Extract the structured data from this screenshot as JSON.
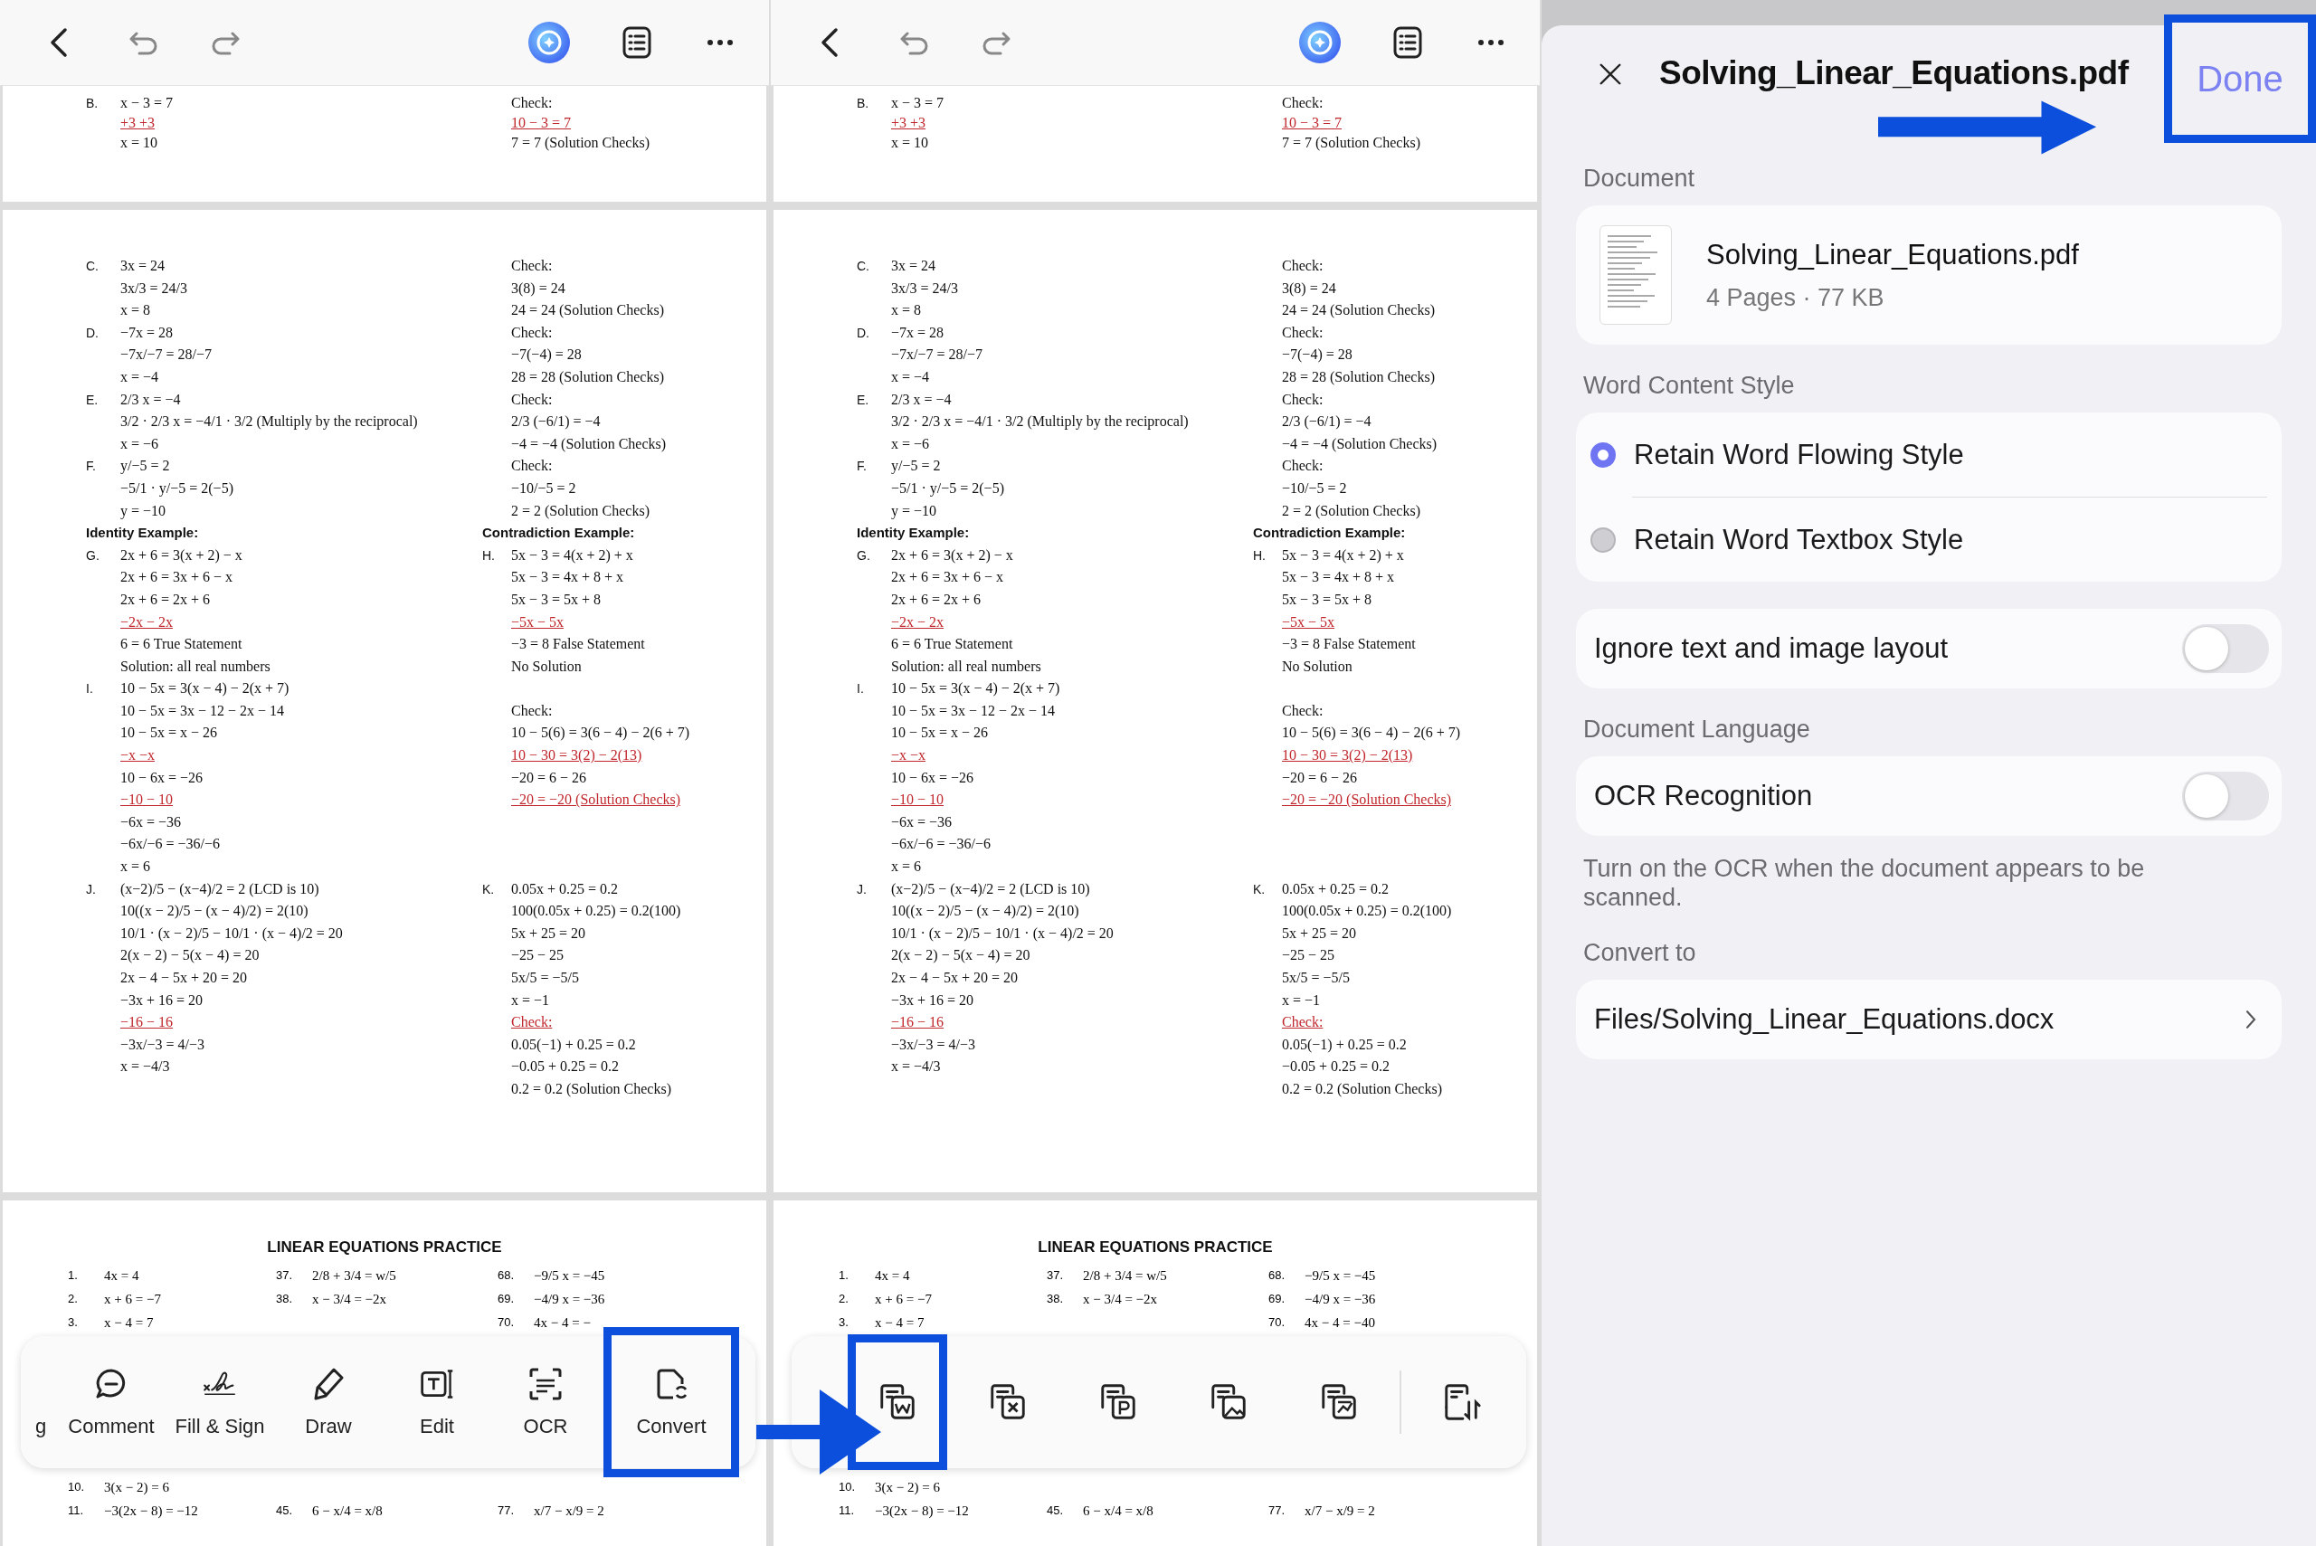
{
  "viewers": [
    {
      "top_page": {
        "rows": [
          {
            "left_label": "B.",
            "left": "x − 3 = 7",
            "right": "Check:"
          },
          {
            "left": "+3 +3",
            "right": "10 − 3 = 7",
            "kind": "work"
          },
          {
            "left": "x = 10",
            "right": "7 = 7 (Solution Checks)"
          }
        ]
      },
      "worked_page": {
        "rows": [
          {
            "left_label": "C.",
            "left": "3x = 24",
            "right": "Check:"
          },
          {
            "left": "3x/3 = 24/3",
            "right": "3(8) = 24"
          },
          {
            "left": "x = 8",
            "right": "24 = 24 (Solution Checks)"
          },
          {
            "left_label": "D.",
            "left": "−7x = 28",
            "right": "Check:"
          },
          {
            "left": "−7x/−7 = 28/−7",
            "right": "−7(−4) = 28"
          },
          {
            "left": "x = −4",
            "right": "28 = 28 (Solution Checks)"
          },
          {
            "left_label": "E.",
            "left": "2/3 x = −4",
            "right": "Check:"
          },
          {
            "left": "3/2 · 2/3 x = −4/1 · 3/2 (Multiply by the reciprocal)",
            "right": "2/3 (−6/1) = −4"
          },
          {
            "left": "x = −6",
            "right": "−4 = −4 (Solution Checks)"
          },
          {
            "left_label": "F.",
            "left": "y/−5 = 2",
            "right": "Check:"
          },
          {
            "left": "−5/1 · y/−5 = 2(−5)",
            "right": "−10/−5 = 2"
          },
          {
            "left": "y = −10",
            "right": "2 = 2 (Solution Checks)"
          },
          {
            "left": "Identity Example:",
            "right": "Contradiction Example:",
            "kind": "heading"
          },
          {
            "left_label": "G.",
            "left": "2x + 6 = 3(x + 2) − x",
            "right_label": "H.",
            "right": "5x − 3 = 4(x + 2) + x"
          },
          {
            "left": "2x + 6 = 3x + 6 − x",
            "right": "5x − 3 = 4x + 8 + x"
          },
          {
            "left": "2x + 6 = 2x + 6",
            "right": "5x − 3 = 5x + 8"
          },
          {
            "left": "−2x   − 2x",
            "right": "−5x   − 5x",
            "kind": "work"
          },
          {
            "left": "6 = 6   True Statement",
            "right": "−3 = 8   False Statement"
          },
          {
            "left": "Solution: all real numbers",
            "right": "No Solution"
          },
          {
            "left_label": "I.",
            "left": "10 − 5x = 3(x − 4) − 2(x + 7)"
          },
          {
            "left": "10 − 5x = 3x − 12 − 2x − 14",
            "right": "Check:"
          },
          {
            "left": "10 − 5x = x − 26",
            "right": "10 − 5(6) = 3(6 − 4) − 2(6 + 7)"
          },
          {
            "left": "−x  −x",
            "right": "10 − 30 = 3(2) − 2(13)",
            "kind": "work"
          },
          {
            "left": "10 − 6x = −26",
            "right": "−20 = 6 − 26"
          },
          {
            "left": "−10   − 10",
            "right": "−20 = −20 (Solution Checks)",
            "kind": "work"
          },
          {
            "left": "−6x = −36"
          },
          {
            "left": "−6x/−6 = −36/−6"
          },
          {
            "left": "x = 6"
          },
          {
            "left_label": "J.",
            "left": "(x−2)/5 − (x−4)/2 = 2 (LCD is 10)",
            "right_label": "K.",
            "right": "0.05x + 0.25 = 0.2"
          },
          {
            "left": "10((x − 2)/5 − (x − 4)/2) = 2(10)",
            "right": "100(0.05x + 0.25) = 0.2(100)"
          },
          {
            "left": "10/1 · (x − 2)/5 − 10/1 · (x − 4)/2 = 20",
            "right": "5x + 25 = 20"
          },
          {
            "left": "2(x − 2) − 5(x − 4) = 20",
            "right": "−25 − 25"
          },
          {
            "left": "2x − 4 − 5x + 20 = 20",
            "right": "5x/5 = −5/5"
          },
          {
            "left": "−3x + 16 = 20",
            "right": "x = −1"
          },
          {
            "left": "−16 − 16",
            "right": "Check:",
            "kind": "work"
          },
          {
            "left": "−3x/−3 = 4/−3",
            "right": "0.05(−1) + 0.25 = 0.2"
          },
          {
            "left": "x = −4/3",
            "right": "−0.05 + 0.25 = 0.2"
          },
          {
            "right": "0.2 = 0.2 (Solution Checks)"
          }
        ]
      },
      "practice_page": {
        "title": "LINEAR EQUATIONS PRACTICE",
        "top_rows": [
          {
            "column_1": {
              "num": "1.",
              "text": "4x = 4"
            },
            "column_2": {
              "num": "37.",
              "text": "2/8 + 3/4 = w/5"
            },
            "column_3": {
              "num": "68.",
              "text": "−9/5 x = −45"
            }
          },
          {
            "column_1": {
              "num": "2.",
              "text": "x + 6 = −7"
            },
            "column_2": {
              "num": "38.",
              "text": "x − 3/4 = −2x"
            },
            "column_3": {
              "num": "69.",
              "text": "−4/9 x = −36"
            }
          },
          {
            "column_1": {
              "num": "3.",
              "text": "x − 4 = 7"
            },
            "column_3": {
              "num": "70.",
              "text": "4x − 4 = −"
            }
          }
        ],
        "bottom_rows": [
          {
            "column_1": {
              "num": "10.",
              "text": "3(x − 2) = 6"
            }
          },
          {
            "column_1": {
              "num": "11.",
              "text": "−3(2x − 8) = −12"
            },
            "column_2": {
              "num": "45.",
              "text": "6 − x/4 = x/8"
            },
            "column_3": {
              "num": "77.",
              "text": "x/7 − x/9 = 2"
            }
          }
        ]
      },
      "toolbar": {
        "kind": "tools",
        "items": [
          {
            "label": "g",
            "highlighted": false
          },
          {
            "label": "Comment",
            "kind": "comment",
            "highlighted": false
          },
          {
            "label": "Fill & Sign",
            "kind": "sign",
            "highlighted": false
          },
          {
            "label": "Draw",
            "kind": "pencil",
            "highlighted": false
          },
          {
            "label": "Edit",
            "kind": "edit",
            "highlighted": false
          },
          {
            "label": "OCR",
            "kind": "scan",
            "highlighted": false
          },
          {
            "label": "Convert",
            "kind": "convert",
            "highlighted": true
          }
        ]
      }
    },
    {
      "top_page": {
        "rows": [
          {
            "left_label": "B.",
            "left": "x − 3 = 7",
            "right": "Check:"
          },
          {
            "left": "+3 +3",
            "right": "10 − 3 = 7",
            "kind": "work"
          },
          {
            "left": "x = 10",
            "right": "7 = 7 (Solution Checks)"
          }
        ]
      },
      "worked_page": {
        "rows": [
          {
            "left_label": "C.",
            "left": "3x = 24",
            "right": "Check:"
          },
          {
            "left": "3x/3 = 24/3",
            "right": "3(8) = 24"
          },
          {
            "left": "x = 8",
            "right": "24 = 24 (Solution Checks)"
          },
          {
            "left_label": "D.",
            "left": "−7x = 28",
            "right": "Check:"
          },
          {
            "left": "−7x/−7 = 28/−7",
            "right": "−7(−4) = 28"
          },
          {
            "left": "x = −4",
            "right": "28 = 28 (Solution Checks)"
          },
          {
            "left_label": "E.",
            "left": "2/3 x = −4",
            "right": "Check:"
          },
          {
            "left": "3/2 · 2/3 x = −4/1 · 3/2 (Multiply by the reciprocal)",
            "right": "2/3 (−6/1) = −4"
          },
          {
            "left": "x = −6",
            "right": "−4 = −4 (Solution Checks)"
          },
          {
            "left_label": "F.",
            "left": "y/−5 = 2",
            "right": "Check:"
          },
          {
            "left": "−5/1 · y/−5 = 2(−5)",
            "right": "−10/−5 = 2"
          },
          {
            "left": "y = −10",
            "right": "2 = 2 (Solution Checks)"
          },
          {
            "left": "Identity Example:",
            "right": "Contradiction Example:",
            "kind": "heading"
          },
          {
            "left_label": "G.",
            "left": "2x + 6 = 3(x + 2) − x",
            "right_label": "H.",
            "right": "5x − 3 = 4(x + 2) + x"
          },
          {
            "left": "2x + 6 = 3x + 6 − x",
            "right": "5x − 3 = 4x + 8 + x"
          },
          {
            "left": "2x + 6 = 2x + 6",
            "right": "5x − 3 = 5x + 8"
          },
          {
            "left": "−2x   − 2x",
            "right": "−5x   − 5x",
            "kind": "work"
          },
          {
            "left": "6 = 6   True Statement",
            "right": "−3 = 8   False Statement"
          },
          {
            "left": "Solution: all real numbers",
            "right": "No Solution"
          },
          {
            "left_label": "I.",
            "left": "10 − 5x = 3(x − 4) − 2(x + 7)"
          },
          {
            "left": "10 − 5x = 3x − 12 − 2x − 14",
            "right": "Check:"
          },
          {
            "left": "10 − 5x = x − 26",
            "right": "10 − 5(6) = 3(6 − 4) − 2(6 + 7)"
          },
          {
            "left": "−x  −x",
            "right": "10 − 30 = 3(2) − 2(13)",
            "kind": "work"
          },
          {
            "left": "10 − 6x = −26",
            "right": "−20 = 6 − 26"
          },
          {
            "left": "−10   − 10",
            "right": "−20 = −20 (Solution Checks)",
            "kind": "work"
          },
          {
            "left": "−6x = −36"
          },
          {
            "left": "−6x/−6 = −36/−6"
          },
          {
            "left": "x = 6"
          },
          {
            "left_label": "J.",
            "left": "(x−2)/5 − (x−4)/2 = 2 (LCD is 10)",
            "right_label": "K.",
            "right": "0.05x + 0.25 = 0.2"
          },
          {
            "left": "10((x − 2)/5 − (x − 4)/2) = 2(10)",
            "right": "100(0.05x + 0.25) = 0.2(100)"
          },
          {
            "left": "10/1 · (x − 2)/5 − 10/1 · (x − 4)/2 = 20",
            "right": "5x + 25 = 20"
          },
          {
            "left": "2(x − 2) − 5(x − 4) = 20",
            "right": "−25 − 25"
          },
          {
            "left": "2x − 4 − 5x + 20 = 20",
            "right": "5x/5 = −5/5"
          },
          {
            "left": "−3x + 16 = 20",
            "right": "x = −1"
          },
          {
            "left": "−16 − 16",
            "right": "Check:",
            "kind": "work"
          },
          {
            "left": "−3x/−3 = 4/−3",
            "right": "0.05(−1) + 0.25 = 0.2"
          },
          {
            "left": "x = −4/3",
            "right": "−0.05 + 0.25 = 0.2"
          },
          {
            "right": "0.2 = 0.2 (Solution Checks)"
          }
        ]
      },
      "practice_page": {
        "title": "LINEAR EQUATIONS PRACTICE",
        "top_rows": [
          {
            "column_1": {
              "num": "1.",
              "text": "4x = 4"
            },
            "column_2": {
              "num": "37.",
              "text": "2/8 + 3/4 = w/5"
            },
            "column_3": {
              "num": "68.",
              "text": "−9/5 x = −45"
            }
          },
          {
            "column_1": {
              "num": "2.",
              "text": "x + 6 = −7"
            },
            "column_2": {
              "num": "38.",
              "text": "x − 3/4 = −2x"
            },
            "column_3": {
              "num": "69.",
              "text": "−4/9 x = −36"
            }
          },
          {
            "column_1": {
              "num": "3.",
              "text": "x − 4 = 7"
            },
            "column_3": {
              "num": "70.",
              "text": "4x − 4 = −40"
            }
          }
        ],
        "bottom_rows": [
          {
            "column_1": {
              "num": "10.",
              "text": "3(x − 2) = 6"
            }
          },
          {
            "column_1": {
              "num": "11.",
              "text": "−3(2x − 8) = −12"
            },
            "column_2": {
              "num": "45.",
              "text": "6 − x/4 = x/8"
            },
            "column_3": {
              "num": "77.",
              "text": "x/7 − x/9 = 2"
            }
          }
        ]
      },
      "toolbar": {
        "kind": "formats",
        "items": [
          {
            "kind": "word",
            "highlighted": true
          },
          {
            "kind": "cross",
            "highlighted": false
          },
          {
            "kind": "badge",
            "highlighted": false
          },
          {
            "kind": "image",
            "highlighted": false
          },
          {
            "kind": "chart",
            "highlighted": false
          },
          {
            "kind": "sort",
            "highlighted": false
          }
        ]
      }
    }
  ],
  "panel": {
    "title": "Solving_Linear_Equations.pdf",
    "done": {
      "label": "Done",
      "highlighted": true
    },
    "document_label": "Document",
    "file_name": "Solving_Linear_Equations.pdf",
    "file_meta": "4 Pages · 77 KB",
    "style_label": "Word Content Style",
    "style_options": [
      {
        "label": "Retain Word Flowing Style",
        "selected": true
      },
      {
        "label": "Retain Word Textbox Style",
        "selected": false
      }
    ],
    "ignore_layout": {
      "label": "Ignore text and image layout",
      "on": false
    },
    "language_label": "Document Language",
    "ocr": {
      "label": "OCR Recognition",
      "on": false
    },
    "ocr_note": "Turn on the OCR when the document appears to be scanned.",
    "convert_label": "Convert to",
    "convert_path": "Files/Solving_Linear_Equations.docx"
  }
}
